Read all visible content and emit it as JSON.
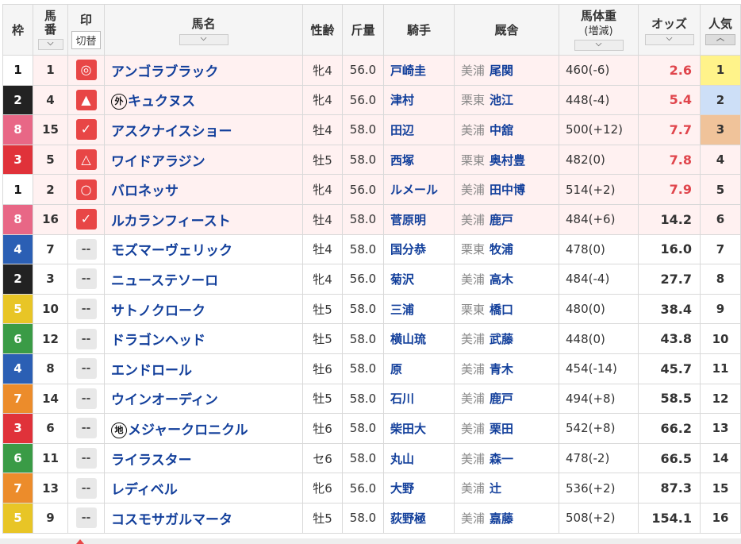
{
  "header": {
    "waku": "枠",
    "umaban_line1": "馬",
    "umaban_line2": "番",
    "mark": "印",
    "mark_switch": "切替",
    "name": "馬名",
    "sex_age": "性齢",
    "kinryo": "斤量",
    "jockey": "騎手",
    "stable": "厩舎",
    "weight_line1": "馬体重",
    "weight_line2": "(増減)",
    "odds": "オッズ",
    "popularity": "人気",
    "sort_glyph": "⌵",
    "sort_up_glyph": "︿"
  },
  "rows": [
    {
      "waku": "1",
      "waku_color": "w1",
      "umaban": "1",
      "mark": "◎",
      "mark_type": "hot",
      "prefix": "",
      "name": "アンゴラブラック",
      "sex": "牝4",
      "kinryo": "56.0",
      "jockey": "戸崎圭",
      "area": "美浦",
      "trainer": "尾関",
      "weight": "460(-6)",
      "odds": "2.6",
      "odds_hot": true,
      "pop": "1",
      "hl": true
    },
    {
      "waku": "2",
      "waku_color": "w2",
      "umaban": "4",
      "mark": "▲",
      "mark_type": "hot",
      "prefix": "外",
      "name": "キュクヌス",
      "sex": "牝4",
      "kinryo": "56.0",
      "jockey": "津村",
      "area": "栗東",
      "trainer": "池江",
      "weight": "448(-4)",
      "odds": "5.4",
      "odds_hot": true,
      "pop": "2",
      "hl": true
    },
    {
      "waku": "8",
      "waku_color": "w8",
      "umaban": "15",
      "mark": "✓",
      "mark_type": "hot",
      "prefix": "",
      "name": "アスクナイスショー",
      "sex": "牡4",
      "kinryo": "58.0",
      "jockey": "田辺",
      "area": "美浦",
      "trainer": "中舘",
      "weight": "500(+12)",
      "odds": "7.7",
      "odds_hot": true,
      "pop": "3",
      "hl": true
    },
    {
      "waku": "3",
      "waku_color": "w3",
      "umaban": "5",
      "mark": "△",
      "mark_type": "hot",
      "prefix": "",
      "name": "ワイドアラジン",
      "sex": "牡5",
      "kinryo": "58.0",
      "jockey": "西塚",
      "area": "栗東",
      "trainer": "奥村豊",
      "weight": "482(0)",
      "odds": "7.8",
      "odds_hot": true,
      "pop": "4",
      "hl": true
    },
    {
      "waku": "1",
      "waku_color": "w1",
      "umaban": "2",
      "mark": "○",
      "mark_type": "hot",
      "prefix": "",
      "name": "バロネッサ",
      "sex": "牝4",
      "kinryo": "56.0",
      "jockey": "ルメール",
      "area": "美浦",
      "trainer": "田中博",
      "weight": "514(+2)",
      "odds": "7.9",
      "odds_hot": true,
      "pop": "5",
      "hl": true
    },
    {
      "waku": "8",
      "waku_color": "w8",
      "umaban": "16",
      "mark": "✓",
      "mark_type": "hot",
      "prefix": "",
      "name": "ルカランフィースト",
      "sex": "牡4",
      "kinryo": "58.0",
      "jockey": "菅原明",
      "area": "美浦",
      "trainer": "鹿戸",
      "weight": "484(+6)",
      "odds": "14.2",
      "odds_hot": false,
      "pop": "6",
      "hl": true
    },
    {
      "waku": "4",
      "waku_color": "w4",
      "umaban": "7",
      "mark": "--",
      "mark_type": "none",
      "prefix": "",
      "name": "モズマーヴェリック",
      "sex": "牡4",
      "kinryo": "58.0",
      "jockey": "国分恭",
      "area": "栗東",
      "trainer": "牧浦",
      "weight": "478(0)",
      "odds": "16.0",
      "odds_hot": false,
      "pop": "7",
      "hl": false
    },
    {
      "waku": "2",
      "waku_color": "w2",
      "umaban": "3",
      "mark": "--",
      "mark_type": "none",
      "prefix": "",
      "name": "ニューステソーロ",
      "sex": "牝4",
      "kinryo": "56.0",
      "jockey": "菊沢",
      "area": "美浦",
      "trainer": "高木",
      "weight": "484(-4)",
      "odds": "27.7",
      "odds_hot": false,
      "pop": "8",
      "hl": false
    },
    {
      "waku": "5",
      "waku_color": "w5",
      "umaban": "10",
      "mark": "--",
      "mark_type": "none",
      "prefix": "",
      "name": "サトノクローク",
      "sex": "牡5",
      "kinryo": "58.0",
      "jockey": "三浦",
      "area": "栗東",
      "trainer": "橋口",
      "weight": "480(0)",
      "odds": "38.4",
      "odds_hot": false,
      "pop": "9",
      "hl": false
    },
    {
      "waku": "6",
      "waku_color": "w6",
      "umaban": "12",
      "mark": "--",
      "mark_type": "none",
      "prefix": "",
      "name": "ドラゴンヘッド",
      "sex": "牡5",
      "kinryo": "58.0",
      "jockey": "横山琉",
      "area": "美浦",
      "trainer": "武藤",
      "weight": "448(0)",
      "odds": "43.8",
      "odds_hot": false,
      "pop": "10",
      "hl": false
    },
    {
      "waku": "4",
      "waku_color": "w4",
      "umaban": "8",
      "mark": "--",
      "mark_type": "none",
      "prefix": "",
      "name": "エンドロール",
      "sex": "牡6",
      "kinryo": "58.0",
      "jockey": "原",
      "area": "美浦",
      "trainer": "青木",
      "weight": "454(-14)",
      "odds": "45.7",
      "odds_hot": false,
      "pop": "11",
      "hl": false
    },
    {
      "waku": "7",
      "waku_color": "w7",
      "umaban": "14",
      "mark": "--",
      "mark_type": "none",
      "prefix": "",
      "name": "ウインオーディン",
      "sex": "牡5",
      "kinryo": "58.0",
      "jockey": "石川",
      "area": "美浦",
      "trainer": "鹿戸",
      "weight": "494(+8)",
      "odds": "58.5",
      "odds_hot": false,
      "pop": "12",
      "hl": false
    },
    {
      "waku": "3",
      "waku_color": "w3",
      "umaban": "6",
      "mark": "--",
      "mark_type": "none",
      "prefix": "地",
      "name": "メジャークロニクル",
      "sex": "牡6",
      "kinryo": "58.0",
      "jockey": "柴田大",
      "area": "美浦",
      "trainer": "栗田",
      "weight": "542(+8)",
      "odds": "66.2",
      "odds_hot": false,
      "pop": "13",
      "hl": false
    },
    {
      "waku": "6",
      "waku_color": "w6",
      "umaban": "11",
      "mark": "--",
      "mark_type": "none",
      "prefix": "",
      "name": "ライラスター",
      "sex": "セ6",
      "kinryo": "58.0",
      "jockey": "丸山",
      "area": "美浦",
      "trainer": "森一",
      "weight": "478(-2)",
      "odds": "66.5",
      "odds_hot": false,
      "pop": "14",
      "hl": false
    },
    {
      "waku": "7",
      "waku_color": "w7",
      "umaban": "13",
      "mark": "--",
      "mark_type": "none",
      "prefix": "",
      "name": "レディベル",
      "sex": "牝6",
      "kinryo": "56.0",
      "jockey": "大野",
      "area": "美浦",
      "trainer": "辻",
      "weight": "536(+2)",
      "odds": "87.3",
      "odds_hot": false,
      "pop": "15",
      "hl": false
    },
    {
      "waku": "5",
      "waku_color": "w5",
      "umaban": "9",
      "mark": "--",
      "mark_type": "none",
      "prefix": "",
      "name": "コスモサガルマータ",
      "sex": "牡5",
      "kinryo": "58.0",
      "jockey": "荻野極",
      "area": "美浦",
      "trainer": "嘉藤",
      "weight": "508(+2)",
      "odds": "154.1",
      "odds_hot": false,
      "pop": "16",
      "hl": false
    }
  ]
}
